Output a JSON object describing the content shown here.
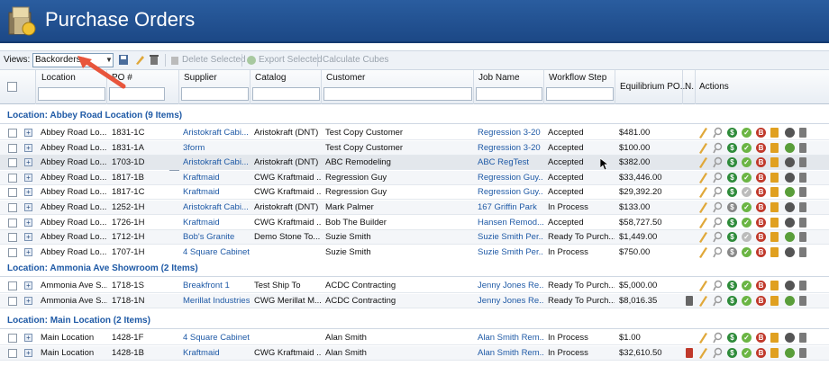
{
  "app": {
    "title": "Purchase Orders"
  },
  "toolbar": {
    "views_label": "Views:",
    "views_value": "Backorders",
    "delete_selected": "Delete Selected",
    "export_selected": "Export Selected",
    "calculate_cubes": "Calculate Cubes"
  },
  "columns": [
    "Location",
    "PO #",
    "Supplier",
    "Catalog",
    "Customer",
    "Job Name",
    "Workflow Step",
    "Equilibrium PO...",
    "N.",
    "Actions"
  ],
  "groups": [
    {
      "label": "Location: Abbey Road Location (9 Items)",
      "rows": [
        {
          "location": "Abbey Road Lo...",
          "po": "1831-1C",
          "supplier": "Aristokraft Cabi...",
          "catalog": "Aristokraft (DNT)",
          "customer": "Test Copy Customer",
          "job": "Regression 3-20",
          "step": "Accepted",
          "amount": "$481.00"
        },
        {
          "location": "Abbey Road Lo...",
          "po": "1831-1A",
          "supplier": "3form",
          "catalog": "",
          "customer": "Test Copy Customer",
          "job": "Regression 3-20",
          "step": "Accepted",
          "amount": "$100.00"
        },
        {
          "location": "Abbey Road Lo...",
          "po": "1703-1D",
          "supplier": "Aristokraft Cabi...",
          "catalog": "Aristokraft (DNT)",
          "customer": "ABC Remodeling",
          "job": "ABC RegTest",
          "step": "Accepted",
          "amount": "$382.00"
        },
        {
          "location": "Abbey Road Lo...",
          "po": "1817-1B",
          "supplier": "Kraftmaid",
          "catalog": "CWG Kraftmaid ...",
          "customer": "Regression Guy",
          "job": "Regression Guy...",
          "step": "Accepted",
          "amount": "$33,446.00"
        },
        {
          "location": "Abbey Road Lo...",
          "po": "1817-1C",
          "supplier": "Kraftmaid",
          "catalog": "CWG Kraftmaid ...",
          "customer": "Regression Guy",
          "job": "Regression Guy...",
          "step": "Accepted",
          "amount": "$29,392.20"
        },
        {
          "location": "Abbey Road Lo...",
          "po": "1252-1H",
          "supplier": "Aristokraft Cabi...",
          "catalog": "Aristokraft (DNT)",
          "customer": "Mark Palmer",
          "job": "167 Griffin Park",
          "step": "In Process",
          "amount": "$133.00"
        },
        {
          "location": "Abbey Road Lo...",
          "po": "1726-1H",
          "supplier": "Kraftmaid",
          "catalog": "CWG Kraftmaid ...",
          "customer": "Bob The Builder",
          "job": "Hansen Remod...",
          "step": "Accepted",
          "amount": "$58,727.50"
        },
        {
          "location": "Abbey Road Lo...",
          "po": "1712-1H",
          "supplier": "Bob's Granite",
          "catalog": "Demo Stone To...",
          "customer": "Suzie Smith",
          "job": "Suzie Smith Per...",
          "step": "Ready To Purch...",
          "amount": "$1,449.00"
        },
        {
          "location": "Abbey Road Lo...",
          "po": "1707-1H",
          "supplier": "4 Square Cabinets",
          "catalog": "",
          "customer": "Suzie Smith",
          "job": "Suzie Smith Per...",
          "step": "In Process",
          "amount": "$750.00"
        }
      ]
    },
    {
      "label": "Location: Ammonia Ave Showroom (2 Items)",
      "rows": [
        {
          "location": "Ammonia Ave S...",
          "po": "1718-1S",
          "supplier": "Breakfront 1",
          "catalog": "Test Ship To",
          "customer": "ACDC Contracting",
          "job": "Jenny Jones Re...",
          "step": "Ready To Purch...",
          "amount": "$5,000.00"
        },
        {
          "location": "Ammonia Ave S...",
          "po": "1718-1N",
          "supplier": "Merillat Industries",
          "catalog": "CWG Merillat M...",
          "customer": "ACDC Contracting",
          "job": "Jenny Jones Re...",
          "step": "Ready To Purch...",
          "amount": "$8,016.35"
        }
      ]
    },
    {
      "label": "Location: Main Location (2 Items)",
      "rows": [
        {
          "location": "Main Location",
          "po": "1428-1F",
          "supplier": "4 Square Cabinets",
          "catalog": "",
          "customer": "Alan Smith",
          "job": "Alan Smith Rem...",
          "step": "In Process",
          "amount": "$1.00"
        },
        {
          "location": "Main Location",
          "po": "1428-1B",
          "supplier": "Kraftmaid",
          "catalog": "CWG Kraftmaid ...",
          "customer": "Alan Smith",
          "job": "Alan Smith Rem...",
          "step": "In Process",
          "amount": "$32,610.50"
        }
      ]
    }
  ],
  "colors": {
    "header": "#1c4886",
    "link": "#1f5aa6",
    "group": "#1f5aa6",
    "arrow": "#e8553c"
  },
  "icons": [
    "pencil-icon",
    "search-doc-icon",
    "dollar-icon",
    "check-icon",
    "b-badge-icon",
    "note-icon",
    "globe-icon",
    "trash-icon"
  ]
}
